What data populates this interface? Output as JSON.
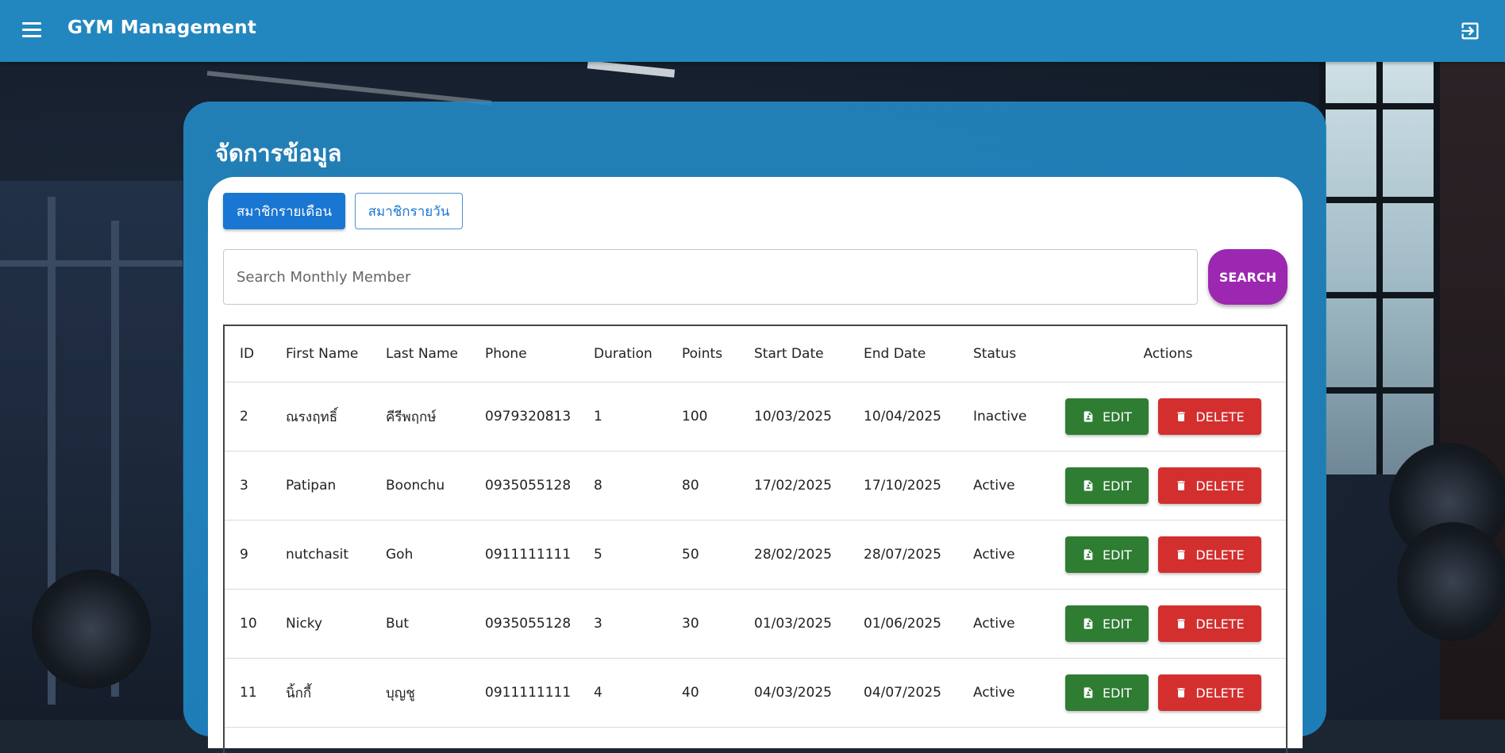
{
  "app": {
    "title": "GYM Management"
  },
  "panel": {
    "title": "จัดการข้อมูล"
  },
  "tabs": [
    {
      "label": "สมาชิกรายเดือน",
      "active": true
    },
    {
      "label": "สมาชิกรายวัน",
      "active": false
    }
  ],
  "search": {
    "placeholder": "Search Monthly Member",
    "value": "",
    "button_label": "SEARCH"
  },
  "table": {
    "headers": [
      "ID",
      "First Name",
      "Last Name",
      "Phone",
      "Duration",
      "Points",
      "Start Date",
      "End Date",
      "Status",
      "Actions"
    ],
    "rows": [
      {
        "id": "2",
        "first": "ณรงฤทธิ์",
        "last": "คีรีพฤกษ์",
        "phone": "0979320813",
        "duration": "1",
        "points": "100",
        "start": "10/03/2025",
        "end": "10/04/2025",
        "status": "Inactive"
      },
      {
        "id": "3",
        "first": "Patipan",
        "last": "Boonchu",
        "phone": "0935055128",
        "duration": "8",
        "points": "80",
        "start": "17/02/2025",
        "end": "17/10/2025",
        "status": "Active"
      },
      {
        "id": "9",
        "first": "nutchasit",
        "last": "Goh",
        "phone": "0911111111",
        "duration": "5",
        "points": "50",
        "start": "28/02/2025",
        "end": "28/07/2025",
        "status": "Active"
      },
      {
        "id": "10",
        "first": "Nicky",
        "last": "But",
        "phone": "0935055128",
        "duration": "3",
        "points": "30",
        "start": "01/03/2025",
        "end": "01/06/2025",
        "status": "Active"
      },
      {
        "id": "11",
        "first": "นิ้กกี้",
        "last": "บุญชู",
        "phone": "0911111111",
        "duration": "4",
        "points": "40",
        "start": "04/03/2025",
        "end": "04/07/2025",
        "status": "Active"
      }
    ],
    "edit_label": "EDIT",
    "delete_label": "DELETE"
  },
  "colors": {
    "topbar": "#2387bf",
    "tab_active": "#1976d2",
    "search_button": "#9c27b0",
    "edit_button": "#2e7d32",
    "delete_button": "#d32f2f"
  },
  "icons": {
    "menu": "menu-icon",
    "logout": "logout-icon",
    "edit": "document-person-icon",
    "delete": "trash-icon"
  }
}
